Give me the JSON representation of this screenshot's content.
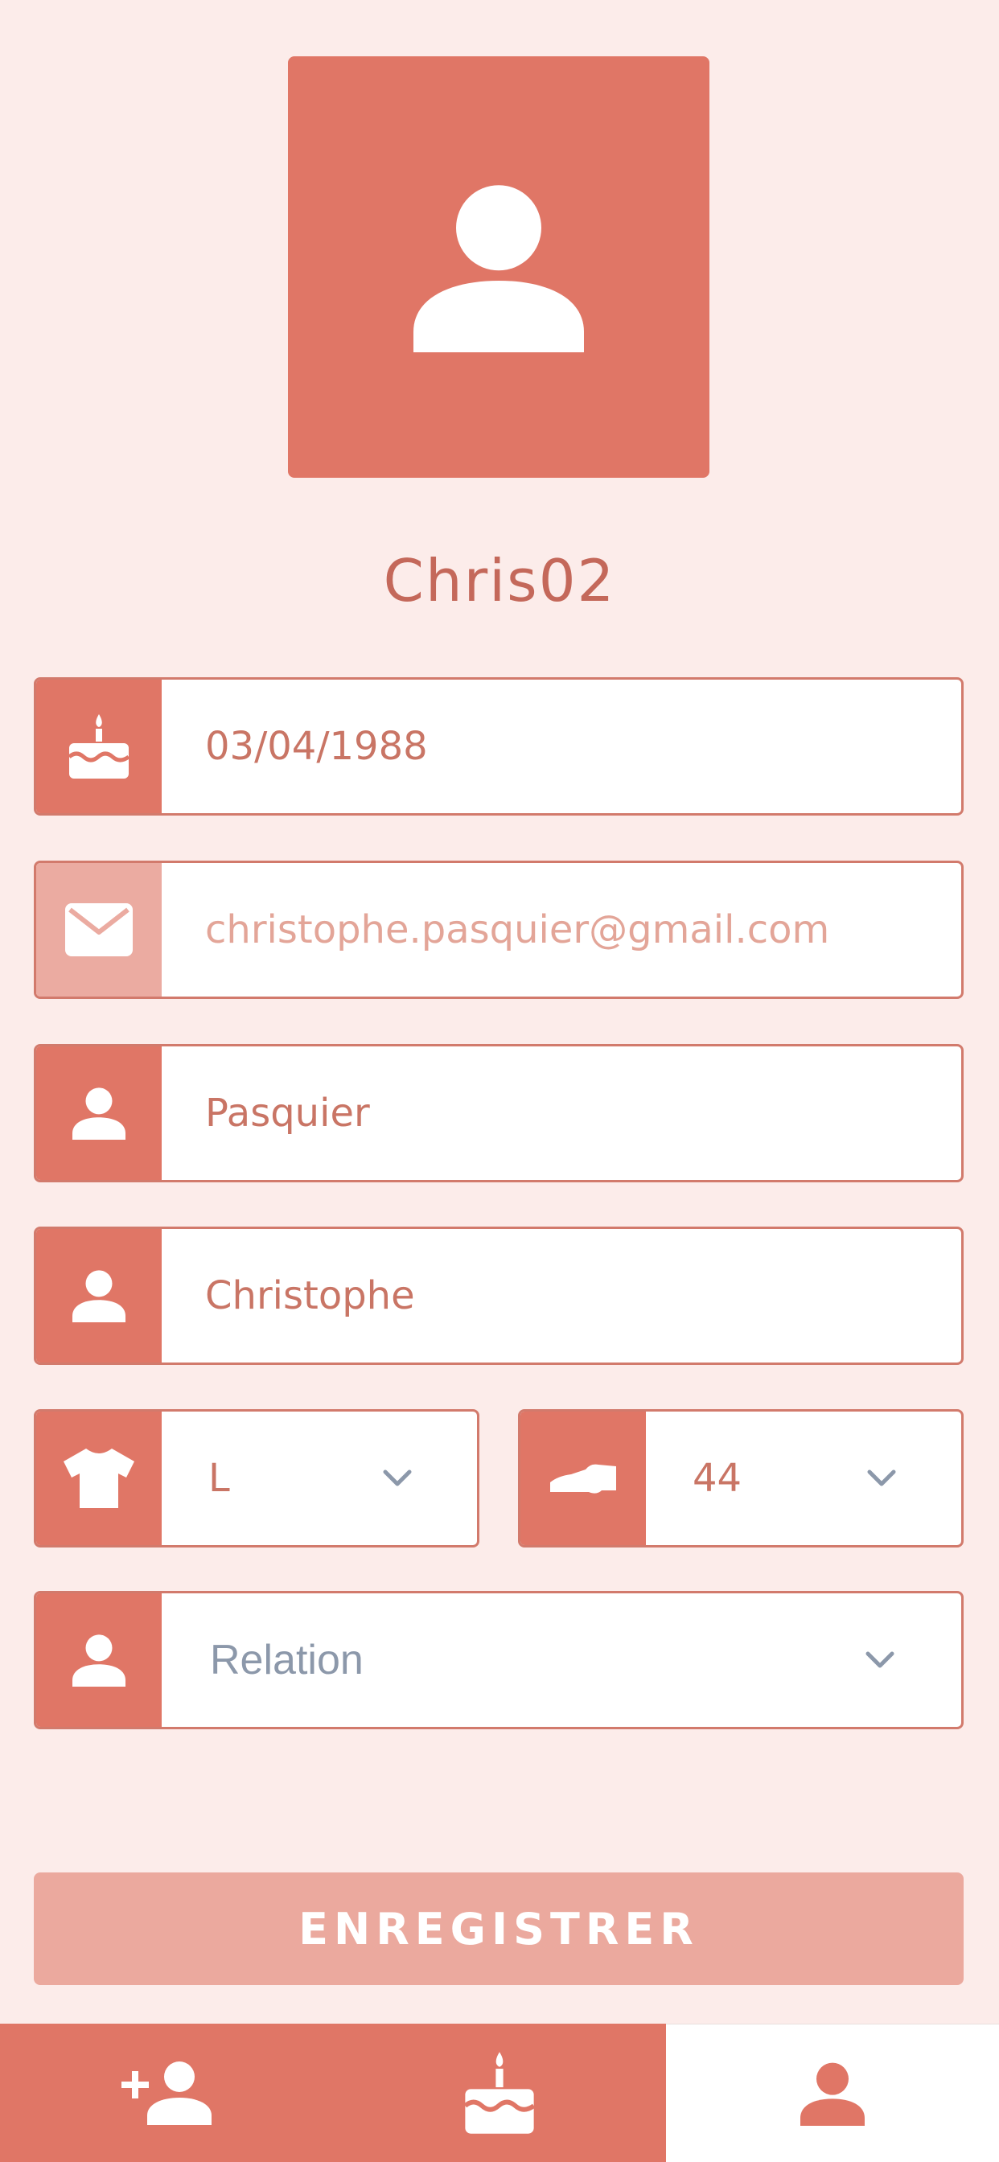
{
  "profile": {
    "username": "Chris02",
    "avatar_icon": "user-icon"
  },
  "fields": {
    "birthday": {
      "value": "03/04/1988",
      "icon": "cake-icon"
    },
    "email": {
      "value": "christophe.pasquier@gmail.com",
      "icon": "mail-icon"
    },
    "last_name": {
      "value": "Pasquier",
      "icon": "user-icon"
    },
    "first_name": {
      "value": "Christophe",
      "icon": "user-icon"
    },
    "shirt_size": {
      "value": "L",
      "icon": "shirt-icon"
    },
    "shoe_size": {
      "value": "44",
      "icon": "shoe-icon"
    },
    "relation": {
      "value": "Relation",
      "icon": "user-icon"
    }
  },
  "save_button": {
    "label": "ENREGISTRER"
  },
  "bottom_nav": {
    "items": [
      {
        "icon": "add-user-icon",
        "active": false
      },
      {
        "icon": "cake-icon",
        "active": false
      },
      {
        "icon": "user-icon",
        "active": true
      }
    ]
  },
  "colors": {
    "background": "#fcecea",
    "accent": "#e07666",
    "accent_light": "#ebaba1",
    "text": "#c97565",
    "select_text": "#8c98aa",
    "white": "#ffffff"
  }
}
